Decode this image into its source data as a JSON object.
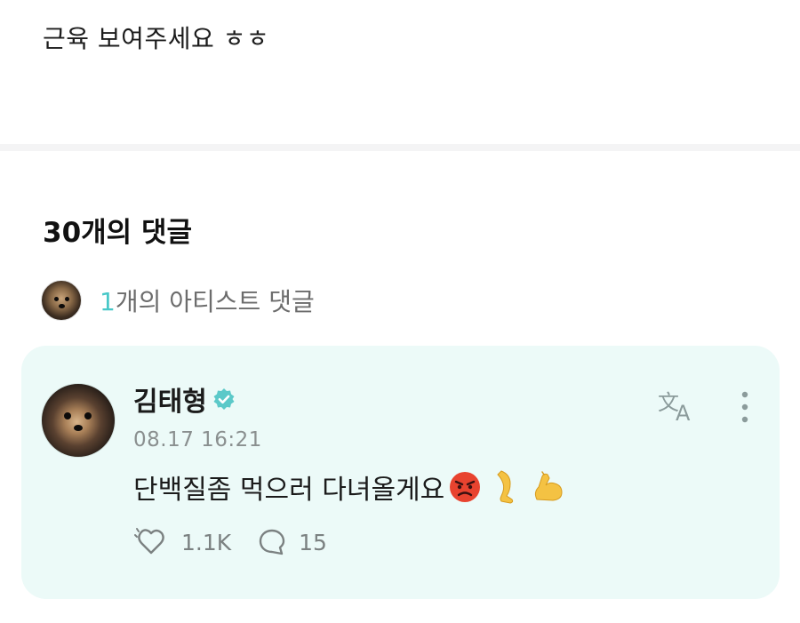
{
  "post": {
    "text": "근육 보여주세요 ㅎㅎ"
  },
  "comments": {
    "title": "30개의 댓글",
    "artist_summary": {
      "count": "1",
      "label": "개의 아티스트 댓글"
    }
  },
  "artist_comment": {
    "author": "김태형",
    "timestamp": "08.17 16:21",
    "text": "단백질좀 먹으러 다녀올게요",
    "emojis": [
      "angry-face-icon",
      "leg-icon",
      "flexed-biceps-icon"
    ],
    "likes": "1.1K",
    "replies": "15"
  },
  "colors": {
    "accent": "#48c8c8",
    "card_background": "#ecfaf8",
    "verified": "#5cc9c9"
  }
}
